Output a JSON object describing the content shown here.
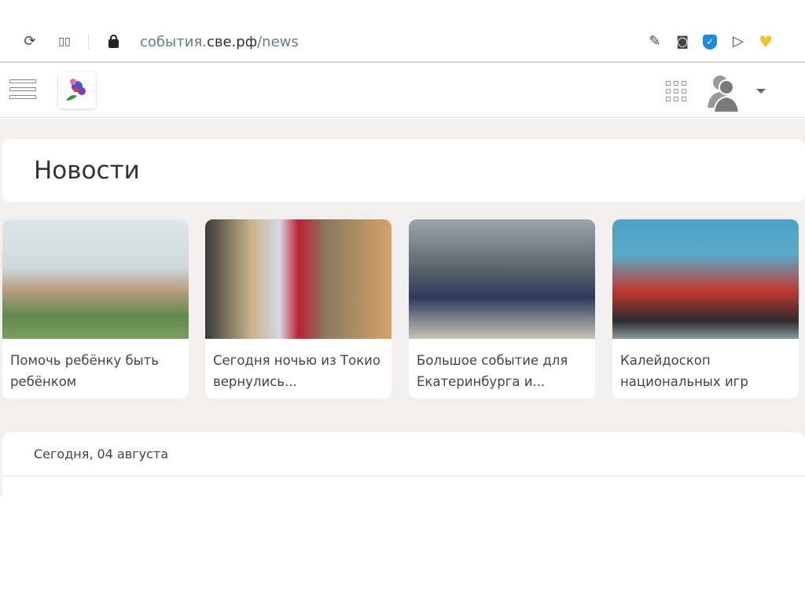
{
  "browser": {
    "url_host_prefix": "события.",
    "url_host_main": "све.рф",
    "url_path": "/news",
    "icons": [
      "reload-icon",
      "tabs-grid-icon",
      "lock-icon",
      "edit-icon",
      "camera-icon",
      "shield-check-icon",
      "send-icon",
      "heart-icon"
    ]
  },
  "page": {
    "title": "Новости",
    "news": [
      {
        "title": "Помочь ребёнку быть ребёнком"
      },
      {
        "title": "Сегодня ночью из Токио вернулись..."
      },
      {
        "title": "Большое событие для Екатеринбурга и..."
      },
      {
        "title": "Калейдоскоп национальных игр"
      }
    ],
    "date_header": "Сегодня, 04 августа"
  },
  "colors": {
    "background": "#f2f0ee",
    "shield": "#1e88e5",
    "heart": "#f2c12e"
  }
}
